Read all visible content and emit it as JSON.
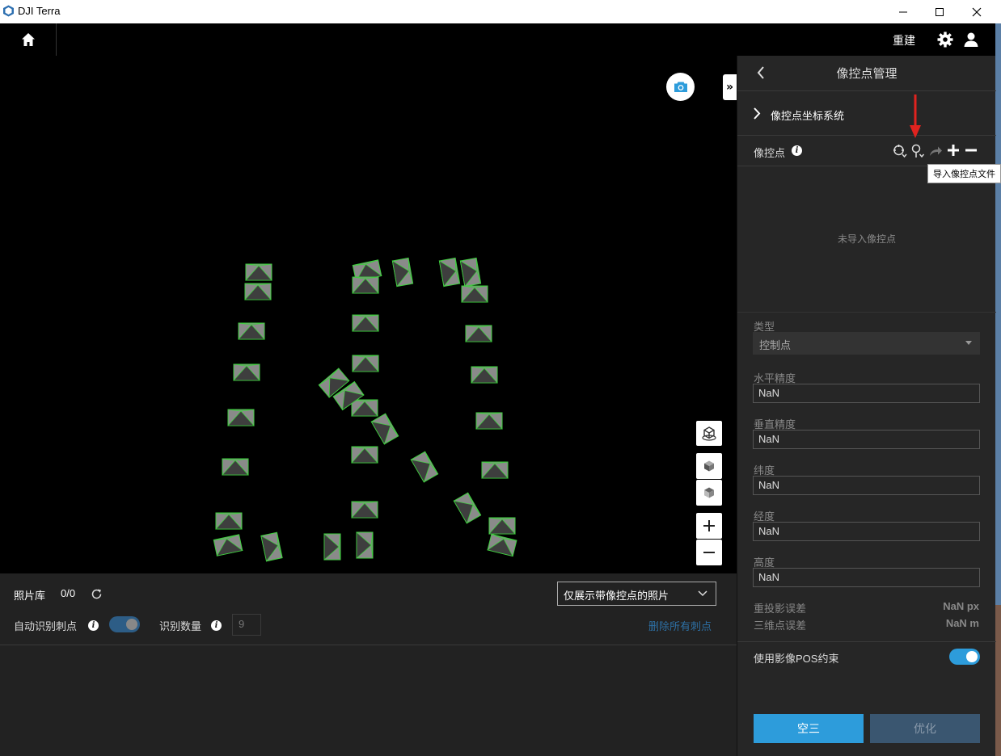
{
  "window": {
    "title": "DJI Terra"
  },
  "toolbar": {
    "rebuild_label": "重建"
  },
  "gallery": {
    "label": "照片库",
    "count": "0/0",
    "filter_selected": "仅展示带像控点的照片",
    "auto_label": "自动识别刺点",
    "recog_count_label": "识别数量",
    "recog_count_value": "9",
    "delete_all_label": "删除所有刺点",
    "auto_enabled": true
  },
  "side": {
    "title": "像控点管理",
    "coord_system_label": "像控点坐标系统",
    "gcp_label": "像控点",
    "empty_text": "未导入像控点",
    "tooltip": "导入像控点文件",
    "type_label": "类型",
    "type_value": "控制点",
    "fields": [
      {
        "label": "水平精度",
        "value": "NaN"
      },
      {
        "label": "垂直精度",
        "value": "NaN"
      },
      {
        "label": "纬度",
        "value": "NaN"
      },
      {
        "label": "经度",
        "value": "NaN"
      },
      {
        "label": "高度",
        "value": "NaN"
      }
    ],
    "reproj_label": "重投影误差",
    "reproj_value": "NaN px",
    "point3d_label": "三维点误差",
    "point3d_value": "NaN m",
    "pos_label": "使用影像POS约束",
    "pos_enabled": true,
    "aat_label": "空三",
    "optimize_label": "优化"
  },
  "colors": {
    "accent": "#2d9cdb",
    "camera_outline": "#3fcf3f",
    "disabled_button": "#3a5670"
  }
}
